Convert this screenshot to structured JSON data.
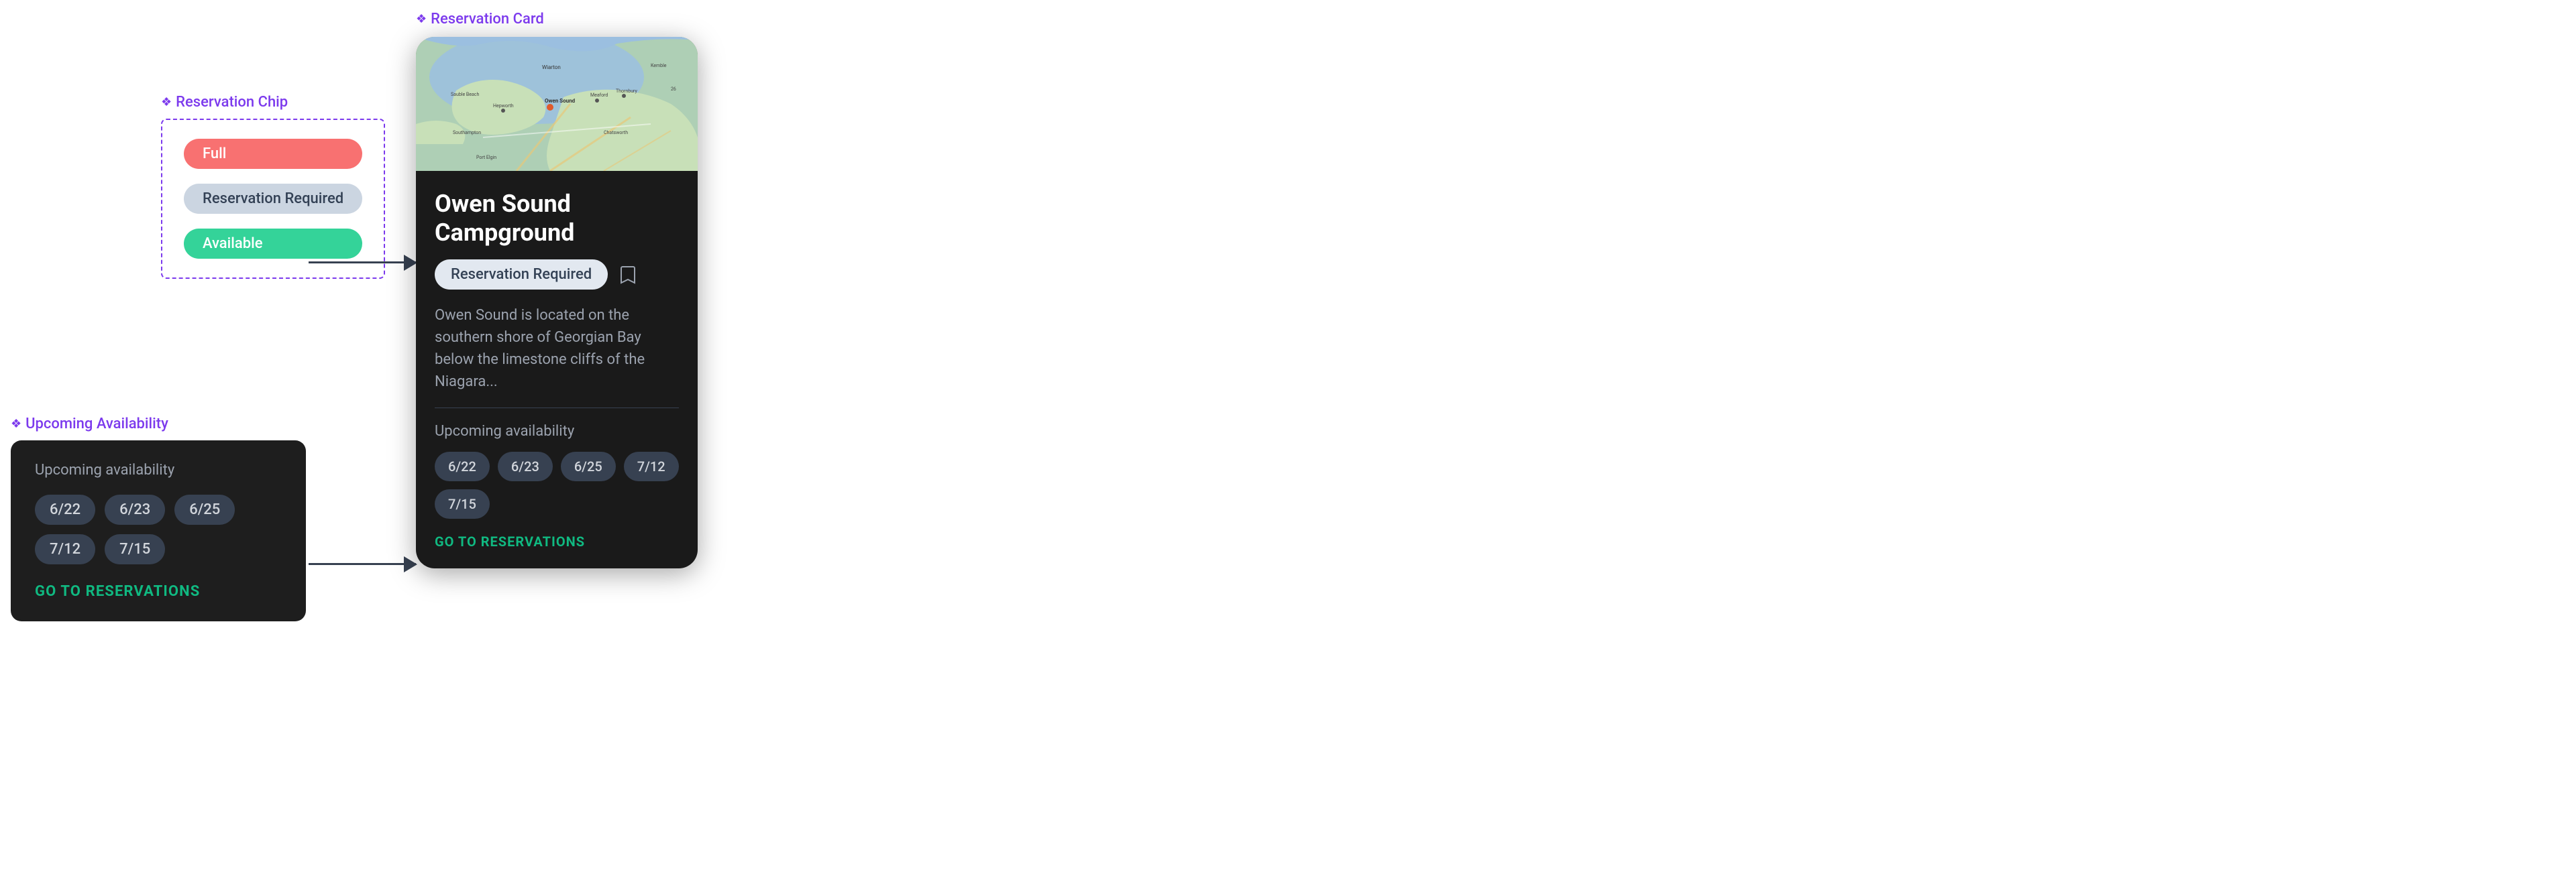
{
  "page": {
    "background": "#ffffff"
  },
  "reservationChip": {
    "label": "Reservation Chip",
    "chips": [
      {
        "text": "Full",
        "type": "full"
      },
      {
        "text": "Reservation Required",
        "type": "reservation"
      },
      {
        "text": "Available",
        "type": "available"
      }
    ]
  },
  "upcomingAvailability": {
    "sectionLabel": "Upcoming Availability",
    "cardLabel": "Upcoming availability",
    "dates": [
      "6/22",
      "6/23",
      "6/25",
      "7/12",
      "7/15"
    ],
    "goToReservations": "GO TO RESERVATIONS"
  },
  "reservationCard": {
    "sectionLabel": "Reservation Card",
    "title": "Owen Sound Campground",
    "chipText": "Reservation Required",
    "description": "Owen Sound is located on the southern shore of Georgian Bay below the limestone cliffs of the Niagara...",
    "upcomingLabel": "Upcoming availability",
    "dates": [
      "6/22",
      "6/23",
      "6/25",
      "7/12",
      "7/15"
    ],
    "goToReservations": "GO TO RESERVATIONS"
  },
  "arrows": [
    {
      "id": "arrow-chip",
      "label": "chip-to-card-arrow"
    },
    {
      "id": "arrow-upcoming",
      "label": "upcoming-to-card-arrow"
    }
  ]
}
